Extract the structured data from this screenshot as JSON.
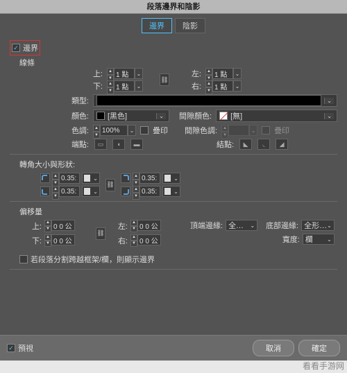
{
  "dialog": {
    "title": "段落邊界和陰影"
  },
  "tabs": {
    "border": "邊界",
    "shadow": "陰影"
  },
  "borderPanel": {
    "enable": "邊界",
    "strokeGroup": "線條",
    "top": "上:",
    "bottom": "下:",
    "left": "左:",
    "right": "右:",
    "unit": "1 點",
    "type": "類型:",
    "color": "顏色:",
    "colorValue": "[黑色]",
    "gapColor": "間隙顏色:",
    "gapColorValue": "[無]",
    "tint": "色調:",
    "tintValue": "100%",
    "overprint": "疊印",
    "gapTint": "間隙色調:",
    "gapOverprint": "疊印",
    "cap": "端點:",
    "join": "結點:"
  },
  "corners": {
    "title": "轉角大小與形狀:",
    "value": "0.35:"
  },
  "offsets": {
    "title": "偏移量",
    "top": "上:",
    "bottom": "下:",
    "left": "左:",
    "right": "右:",
    "val": "0 0 公",
    "topEdge": "頂端邊緣:",
    "topEdgeVal": "全…",
    "bottomEdge": "底部邊緣:",
    "bottomEdgeVal": "全形…",
    "width": "寬度:",
    "widthVal": "欄"
  },
  "splitNote": "若段落分割跨越框架/欄，則顯示邊界",
  "preview": "預視",
  "buttons": {
    "cancel": "取消",
    "ok": "確定"
  },
  "watermark": "看看手游网"
}
